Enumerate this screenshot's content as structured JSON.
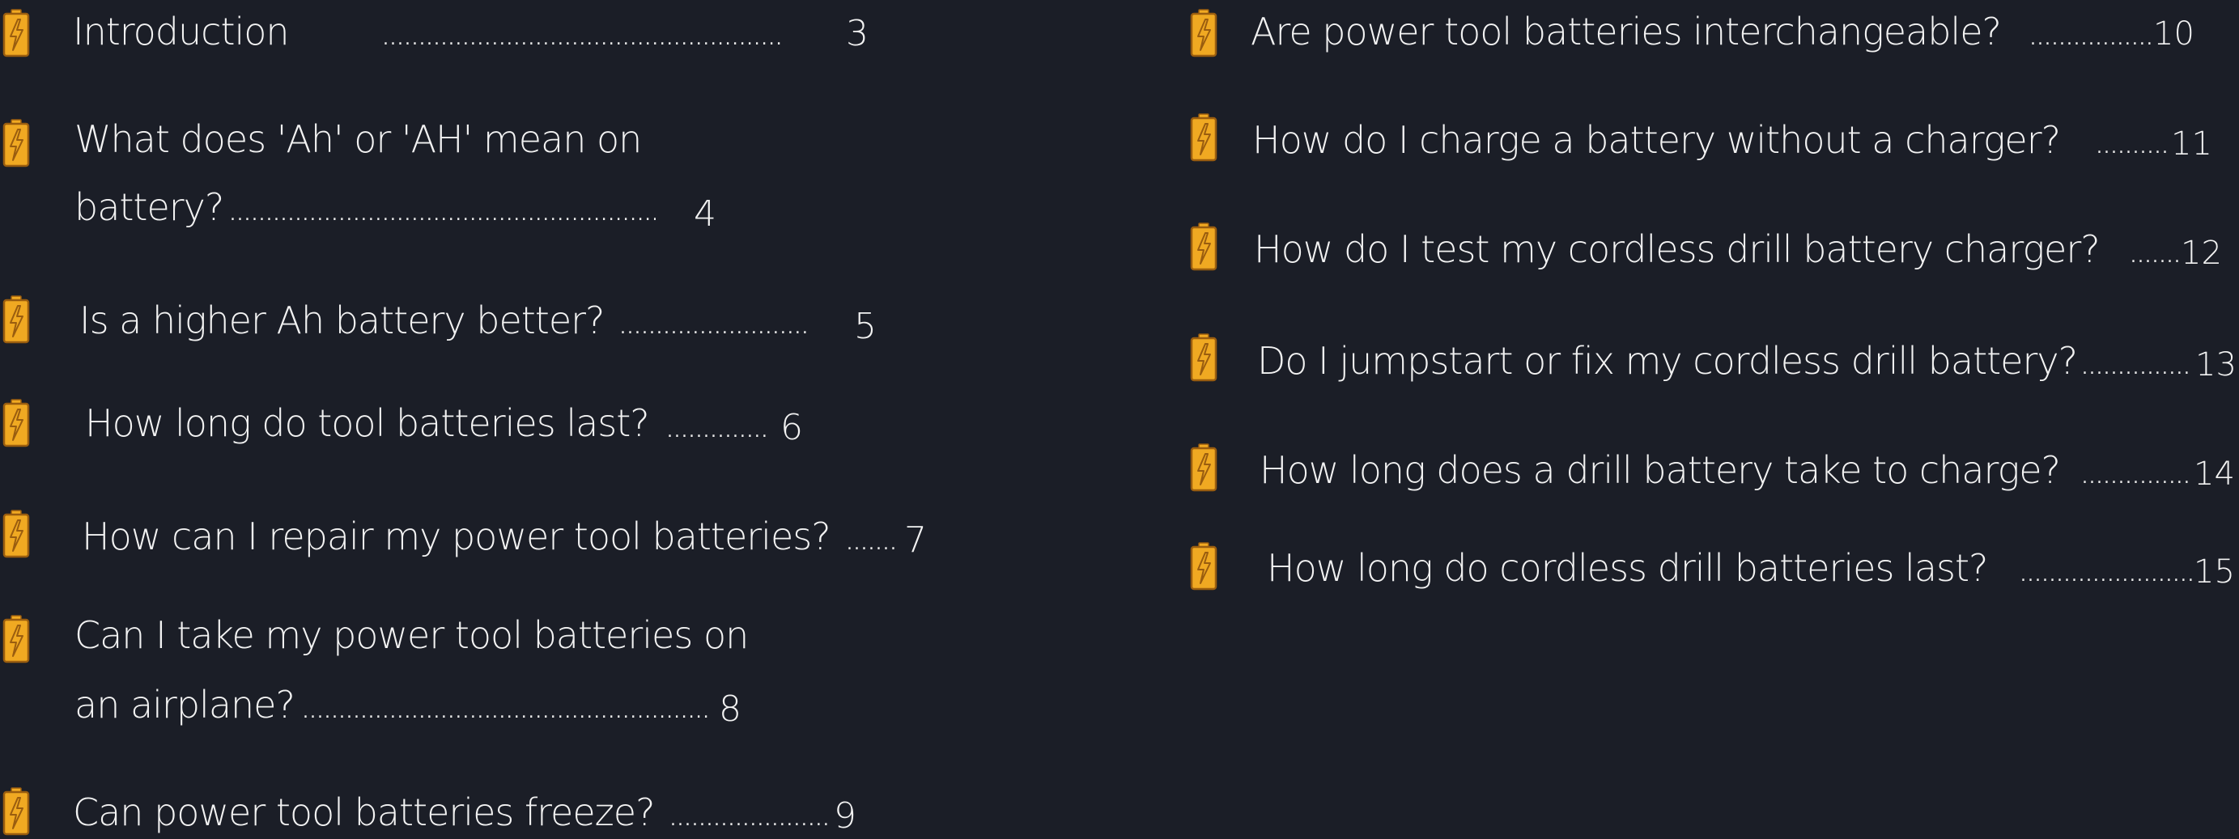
{
  "colors": {
    "background": "#1b1e27",
    "text": "#f2f2f2",
    "icon_fill": "#f0a922",
    "icon_stroke": "#9a5d0f"
  },
  "entry_icon": "battery-charging-icon",
  "toc": {
    "left_column": [
      {
        "title_lines": [
          "Introduction"
        ],
        "page": "3"
      },
      {
        "title_lines": [
          "What does 'Ah' or 'AH' mean on",
          "battery?"
        ],
        "page": "4"
      },
      {
        "title_lines": [
          "Is a  higher Ah battery better?"
        ],
        "page": "5"
      },
      {
        "title_lines": [
          "How long do tool batteries last?"
        ],
        "page": "6"
      },
      {
        "title_lines": [
          "How can I repair my power tool batteries?"
        ],
        "page": "7"
      },
      {
        "title_lines": [
          "Can I take my power tool batteries on",
          "an airplane?"
        ],
        "page": "8"
      },
      {
        "title_lines": [
          "Can power tool batteries freeze?"
        ],
        "page": "9"
      }
    ],
    "right_column": [
      {
        "title_lines": [
          "Are  power tool batteries interchangeable?"
        ],
        "page": "10"
      },
      {
        "title_lines": [
          "How do I  charge a  battery without a charger?"
        ],
        "page": "11"
      },
      {
        "title_lines": [
          "How do I  test my cordless drill battery charger?"
        ],
        "page": "12"
      },
      {
        "title_lines": [
          "Do I jumpstart or fix my cordless drill battery?"
        ],
        "page": "13"
      },
      {
        "title_lines": [
          "How long does a drill battery take to charge?"
        ],
        "page": "14"
      },
      {
        "title_lines": [
          "How long do cordless drill batteries  last?"
        ],
        "page": "15"
      }
    ]
  }
}
